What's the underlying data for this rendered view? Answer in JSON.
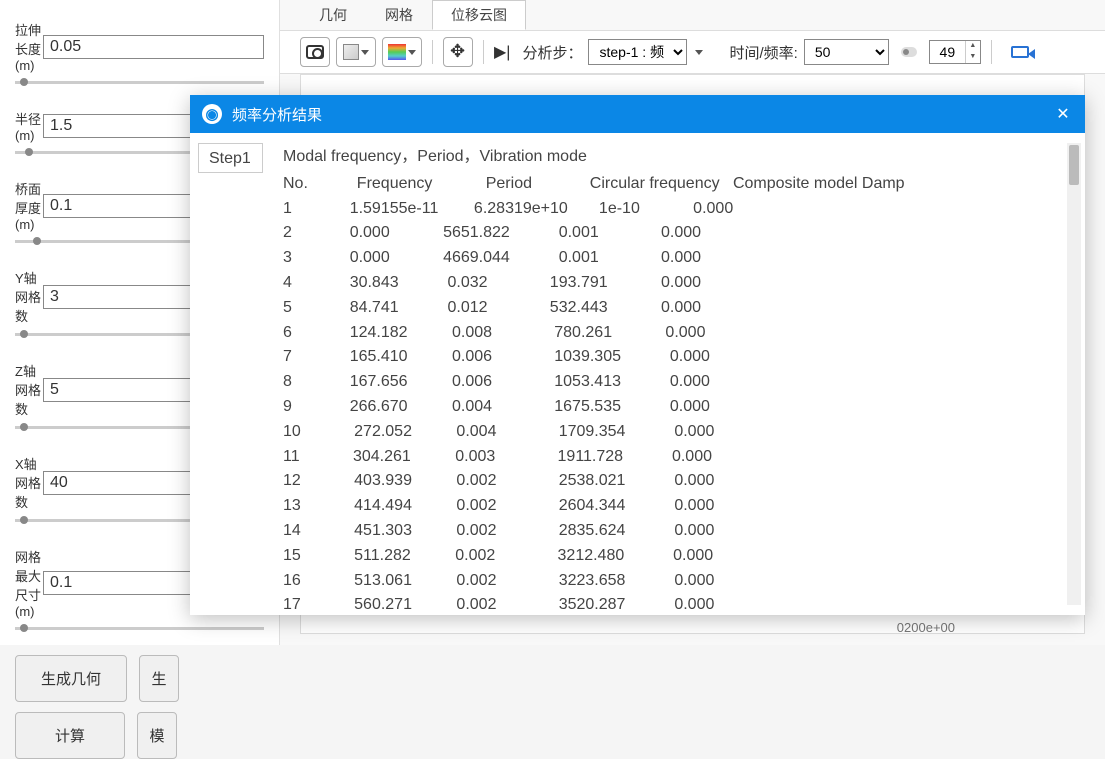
{
  "left_panel": {
    "fields": [
      {
        "label": "拉伸长度(m)",
        "value": "0.05",
        "thumb_pos": "5px"
      },
      {
        "label": "半径(m)",
        "value": "1.5",
        "thumb_pos": "10px"
      },
      {
        "label": "桥面厚度(m)",
        "value": "0.1",
        "thumb_pos": "18px"
      },
      {
        "label": "Y轴网格数",
        "value": "3",
        "thumb_pos": "5px"
      },
      {
        "label": "Z轴网格数",
        "value": "5",
        "thumb_pos": "5px"
      },
      {
        "label": "X轴网格数",
        "value": "40",
        "thumb_pos": "5px"
      },
      {
        "label": "网格最大尺寸(m)",
        "value": "0.1",
        "thumb_pos": "5px"
      }
    ],
    "buttons": {
      "generate_geom": "生成几何",
      "btn2": "生",
      "compute": "计算",
      "btn4": "模"
    }
  },
  "tabs": [
    {
      "label": "几何",
      "active": false
    },
    {
      "label": "网格",
      "active": false
    },
    {
      "label": "位移云图",
      "active": true
    }
  ],
  "toolbar": {
    "analysis_step_label": "分析步：",
    "step_select": "step-1 : 频",
    "time_freq_label": "时间/频率:",
    "time_freq_value": "50",
    "index_value": "49"
  },
  "footer": "0200e+00",
  "dialog": {
    "title": "频率分析结果",
    "step_label": "Step1",
    "header1": "Modal frequency，Period，Vibration mode",
    "columns": "No.           Frequency            Period             Circular frequency   Composite model Damp",
    "rows": [
      {
        "no": "1",
        "freq": "1.59155e-11",
        "period": "6.28319e+10",
        "circ": "1e-10",
        "damp": "0.000"
      },
      {
        "no": "2",
        "freq": "0.000",
        "period": "5651.822",
        "circ": "0.001",
        "damp": "0.000"
      },
      {
        "no": "3",
        "freq": "0.000",
        "period": "4669.044",
        "circ": "0.001",
        "damp": "0.000"
      },
      {
        "no": "4",
        "freq": "30.843",
        "period": "0.032",
        "circ": "193.791",
        "damp": "0.000"
      },
      {
        "no": "5",
        "freq": "84.741",
        "period": "0.012",
        "circ": "532.443",
        "damp": "0.000"
      },
      {
        "no": "6",
        "freq": "124.182",
        "period": "0.008",
        "circ": "780.261",
        "damp": "0.000"
      },
      {
        "no": "7",
        "freq": "165.410",
        "period": "0.006",
        "circ": "1039.305",
        "damp": "0.000"
      },
      {
        "no": "8",
        "freq": "167.656",
        "period": "0.006",
        "circ": "1053.413",
        "damp": "0.000"
      },
      {
        "no": "9",
        "freq": "266.670",
        "period": "0.004",
        "circ": "1675.535",
        "damp": "0.000"
      },
      {
        "no": "10",
        "freq": "272.052",
        "period": "0.004",
        "circ": "1709.354",
        "damp": "0.000"
      },
      {
        "no": "11",
        "freq": "304.261",
        "period": "0.003",
        "circ": "1911.728",
        "damp": "0.000"
      },
      {
        "no": "12",
        "freq": "403.939",
        "period": "0.002",
        "circ": "2538.021",
        "damp": "0.000"
      },
      {
        "no": "13",
        "freq": "414.494",
        "period": "0.002",
        "circ": "2604.344",
        "damp": "0.000"
      },
      {
        "no": "14",
        "freq": "451.303",
        "period": "0.002",
        "circ": "2835.624",
        "damp": "0.000"
      },
      {
        "no": "15",
        "freq": "511.282",
        "period": "0.002",
        "circ": "3212.480",
        "damp": "0.000"
      },
      {
        "no": "16",
        "freq": "513.061",
        "period": "0.002",
        "circ": "3223.658",
        "damp": "0.000"
      },
      {
        "no": "17",
        "freq": "560.271",
        "period": "0.002",
        "circ": "3520.287",
        "damp": "0.000"
      }
    ]
  }
}
